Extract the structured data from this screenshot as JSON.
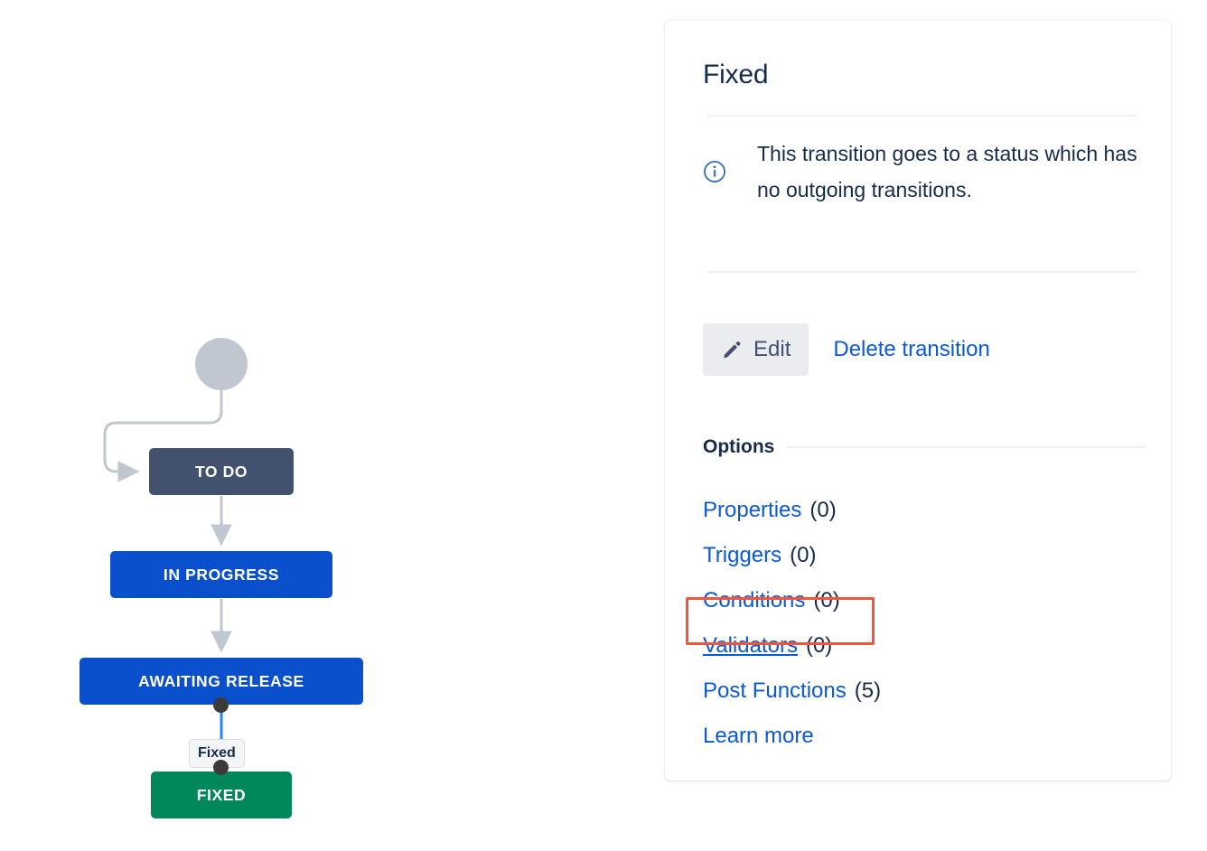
{
  "workflow": {
    "nodes": [
      {
        "id": "start",
        "label": "",
        "type": "start-circle"
      },
      {
        "id": "todo",
        "label": "TO DO",
        "color": "#42526E"
      },
      {
        "id": "inprogress",
        "label": "IN PROGRESS",
        "color": "#0A50CC"
      },
      {
        "id": "awaiting",
        "label": "AWAITING RELEASE",
        "color": "#0A50CC"
      },
      {
        "id": "fixed",
        "label": "FIXED",
        "color": "#00875A"
      }
    ],
    "selected_transition_label": "Fixed",
    "connector_color": "#C1C7D0",
    "selected_connector_color": "#2684FF",
    "endpoint_color": "#3B3B3B"
  },
  "panel": {
    "title": "Fixed",
    "info": {
      "icon": "info-circle-icon",
      "text": "This transition goes to a status which has no outgoing transitions.",
      "color": "#3B73AF"
    },
    "actions": {
      "edit_label": "Edit",
      "edit_icon": "pencil-icon",
      "delete_label": "Delete transition"
    },
    "options": {
      "heading": "Options",
      "items": [
        {
          "label": "Properties",
          "count": "(0)",
          "highlighted": false
        },
        {
          "label": "Triggers",
          "count": "(0)",
          "highlighted": false
        },
        {
          "label": "Conditions",
          "count": "(0)",
          "highlighted": false
        },
        {
          "label": "Validators",
          "count": "(0)",
          "highlighted": true
        },
        {
          "label": "Post Functions",
          "count": "(5)",
          "highlighted": false
        },
        {
          "label": "Learn more",
          "count": "",
          "highlighted": false
        }
      ]
    },
    "link_color": "#0C59D5",
    "highlight_color": "#F4533C"
  }
}
